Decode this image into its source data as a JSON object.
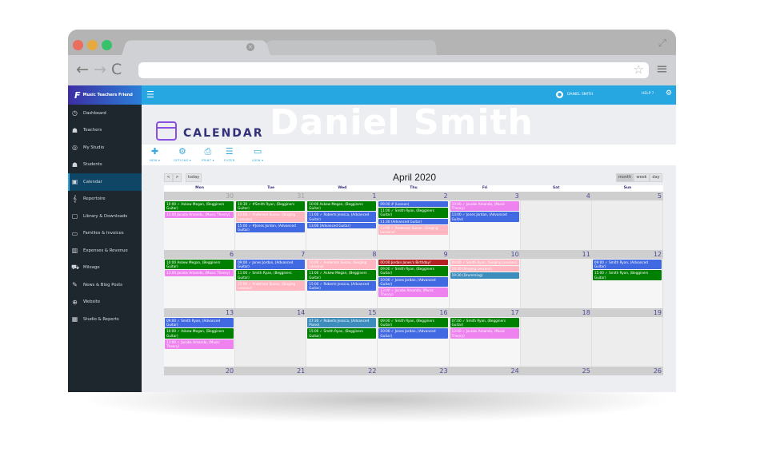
{
  "browser": {
    "traffic_lights": [
      "#e96e5f",
      "#e5a93c",
      "#35c26b"
    ],
    "nav": {
      "back": "←",
      "forward": "→",
      "reload": "C",
      "star": "☆",
      "menu": "≡",
      "expand": "⤢",
      "tab_close": "×"
    },
    "url": ""
  },
  "app": {
    "brand_name": "Music Teachers Friend",
    "brand_logo": "F",
    "user_name": "DANIEL SMITH",
    "help_label": "HELP",
    "watermark_name": "Daniel Smith",
    "page_title": "CALENDAR"
  },
  "sidebar": {
    "items": [
      {
        "label": "Dashboard",
        "icon": "◷",
        "active": false
      },
      {
        "label": "Teachers",
        "icon": "☗",
        "active": false
      },
      {
        "label": "My Studio",
        "icon": "◎",
        "active": false
      },
      {
        "label": "Students",
        "icon": "☗",
        "active": false
      },
      {
        "label": "Calendar",
        "icon": "▣",
        "active": true
      },
      {
        "label": "Repertoire",
        "icon": "𝄞",
        "active": false
      },
      {
        "label": "Library & Downloads",
        "icon": "▢",
        "active": false
      },
      {
        "label": "Families & Invoices",
        "icon": "▭",
        "active": false
      },
      {
        "label": "Expenses & Revenue",
        "icon": "▥",
        "active": false
      },
      {
        "label": "Mileage",
        "icon": "⛟",
        "active": false
      },
      {
        "label": "News & Blog Posts",
        "icon": "✎",
        "active": false
      },
      {
        "label": "Website",
        "icon": "⊕",
        "active": false
      },
      {
        "label": "Studio & Reports",
        "icon": "▦",
        "active": false
      }
    ]
  },
  "toolbar": {
    "items": [
      {
        "label": "NEW ▾",
        "icon": "✚"
      },
      {
        "label": "OPTIONS ▾",
        "icon": "⚙"
      },
      {
        "label": "PRINT ▾",
        "icon": "⎙"
      },
      {
        "label": "FILTER",
        "icon": "☰"
      },
      {
        "label": "VIEW ▾",
        "icon": "▭"
      }
    ]
  },
  "calendar": {
    "title": "April 2020",
    "prev_label": "<",
    "next_label": ">",
    "today_label": "today",
    "views": [
      "month",
      "week",
      "day"
    ],
    "active_view": "month",
    "weekdays": [
      "Mon",
      "Tue",
      "Wed",
      "Thu",
      "Fri",
      "Sat",
      "Sun"
    ],
    "weeks": [
      {
        "days": [
          {
            "num": "30",
            "other": true,
            "events": [
              {
                "text": "10:00 ✓ Askew Megan, (Begginers Guitar)",
                "color": "green"
              },
              {
                "text": "13:00 Jacobs Amanda, (Music Theory)",
                "color": "pink"
              }
            ]
          },
          {
            "num": "31",
            "other": true,
            "events": [
              {
                "text": "10:30 ✓ #Smith Ryan, (Begginers Guitar)",
                "color": "green"
              },
              {
                "text": "13:00 ✓ Anderson Susan, (Singing Lessons)",
                "color": "rose"
              },
              {
                "text": "15:00 ✓ #Jones Jordan, (Advanced Guitar)",
                "color": "blue"
              }
            ]
          },
          {
            "num": "1",
            "other": false,
            "events": [
              {
                "text": "10:00 Askew Megan, (Begginers Guitar)",
                "color": "green"
              },
              {
                "text": "11:00 ✓ Roberts Jessica, (Advanced Guitar)",
                "color": "blue"
              },
              {
                "text": "13:00 (Advanced Guitar)",
                "color": "blue"
              }
            ]
          },
          {
            "num": "2",
            "other": false,
            "events": [
              {
                "text": "09:00 # (Lesson)",
                "color": "blue"
              },
              {
                "text": "11:00 ✓ Smith Ryan, (Begginers Guitar)",
                "color": "green"
              },
              {
                "text": "11:30 (Advanced Guitar)",
                "color": "blue"
              },
              {
                "text": "13:00 ✓ Anderson Susan, (Singing Lessons)",
                "color": "rose"
              }
            ]
          },
          {
            "num": "3",
            "other": false,
            "events": [
              {
                "text": "10:00 ✓ Jacobs Amanda, (Music Theory)",
                "color": "pink"
              },
              {
                "text": "13:00 ✓ Jones Jordan, (Advanced Guitar)",
                "color": "blue"
              }
            ]
          },
          {
            "num": "4",
            "other": false,
            "events": []
          },
          {
            "num": "5",
            "other": false,
            "events": []
          }
        ]
      },
      {
        "days": [
          {
            "num": "6",
            "other": false,
            "events": [
              {
                "text": "10:00 Askew Megan, (Begginers Guitar)",
                "color": "green"
              },
              {
                "text": "13:00 Jacobs Amanda, (Music Theory)",
                "color": "pink"
              }
            ]
          },
          {
            "num": "7",
            "other": false,
            "events": [
              {
                "text": "09:00 ✓ Jones Jordan, (Advanced Guitar)",
                "color": "blue"
              },
              {
                "text": "11:00 ✓ Smith Ryan, (Begginers Guitar)",
                "color": "green"
              },
              {
                "text": "15:00 ✓ Anderson Susan, (Singing Lessons)",
                "color": "rose"
              }
            ]
          },
          {
            "num": "8",
            "other": false,
            "events": [
              {
                "text": "10:00 ✓ Anderson Susan, (Singing Lessons)",
                "color": "rose"
              },
              {
                "text": "11:00 ✓ Askew Megan, (Begginers Guitar)",
                "color": "green"
              },
              {
                "text": "15:00 ✓ Roberts Jessica, (Advanced Guitar)",
                "color": "blue"
              }
            ]
          },
          {
            "num": "9",
            "other": false,
            "events": [
              {
                "text": "00:00 Jordan Jones's Birthday!",
                "color": "red"
              },
              {
                "text": "09:00 ✓ Smith Ryan, (Begginers Guitar)",
                "color": "green"
              },
              {
                "text": "10:00 ✓ Jones Jordan, (Advanced Guitar)",
                "color": "blue"
              },
              {
                "text": "13:00 ✓ Jacobs Amanda, (Music Theory)",
                "color": "pink"
              }
            ]
          },
          {
            "num": "10",
            "other": false,
            "events": [
              {
                "text": "09:00 ✓ Smith Ryan, (Singing Lessons)",
                "color": "rose"
              },
              {
                "text": "16:30 (Singing Lessons)",
                "color": "rose"
              },
              {
                "text": "19:30 (Drumming)",
                "color": "teal"
              }
            ]
          },
          {
            "num": "11",
            "other": false,
            "events": []
          },
          {
            "num": "12",
            "other": false,
            "events": [
              {
                "text": "09:00 ✓ Smith Ryan, (Advanced Guitar)",
                "color": "blue"
              },
              {
                "text": "15:00 ✓ Smith Ryan, (Begginers Guitar)",
                "color": "green"
              }
            ]
          }
        ]
      },
      {
        "days": [
          {
            "num": "13",
            "other": false,
            "events": [
              {
                "text": "09:00 ✓ Smith Ryan, (Advanced Guitar)",
                "color": "blue"
              },
              {
                "text": "10:00 ✓ Askew Megan, (Begginers Guitar)",
                "color": "green"
              },
              {
                "text": "13:00 ✓ Jacobs Amanda, (Music Theory)",
                "color": "pink"
              }
            ]
          },
          {
            "num": "14",
            "other": false,
            "events": []
          },
          {
            "num": "15",
            "other": false,
            "events": [
              {
                "text": "07:30 ✓ Roberts Jessica, (Advanced Piano)",
                "color": "teal"
              },
              {
                "text": "15:00 ✓ Smith Ryan, (Begginers Guitar)",
                "color": "green"
              }
            ]
          },
          {
            "num": "16",
            "other": false,
            "events": [
              {
                "text": "09:00 ✓ Smith Ryan, (Begginers Guitar)",
                "color": "green"
              },
              {
                "text": "10:00 ✓ Jones Jordan, (Advanced Guitar)",
                "color": "blue"
              }
            ]
          },
          {
            "num": "17",
            "other": false,
            "events": [
              {
                "text": "07:00 ✓ Smith Ryan, (Begginers Guitar)",
                "color": "green"
              },
              {
                "text": "13:00 ✓ Jacobs Amanda, (Music Theory)",
                "color": "pink"
              }
            ]
          },
          {
            "num": "18",
            "other": false,
            "events": []
          },
          {
            "num": "19",
            "other": false,
            "events": []
          }
        ]
      },
      {
        "days": [
          {
            "num": "20",
            "other": false,
            "events": []
          },
          {
            "num": "21",
            "other": false,
            "events": []
          },
          {
            "num": "22",
            "other": false,
            "events": []
          },
          {
            "num": "23",
            "other": false,
            "events": []
          },
          {
            "num": "24",
            "other": false,
            "events": []
          },
          {
            "num": "25",
            "other": false,
            "events": []
          },
          {
            "num": "26",
            "other": false,
            "events": []
          }
        ]
      }
    ]
  },
  "colors": {
    "topbar": "#26a7e1",
    "sidebar": "#1e272e",
    "sidebar_active": "#0f4565",
    "title": "#33307a",
    "event_green": "#008000",
    "event_blue": "#4169e1",
    "event_pink": "#ee82ee",
    "event_rose": "#ffb6c1",
    "event_red": "#b22222",
    "event_teal": "#3c8dbc"
  }
}
